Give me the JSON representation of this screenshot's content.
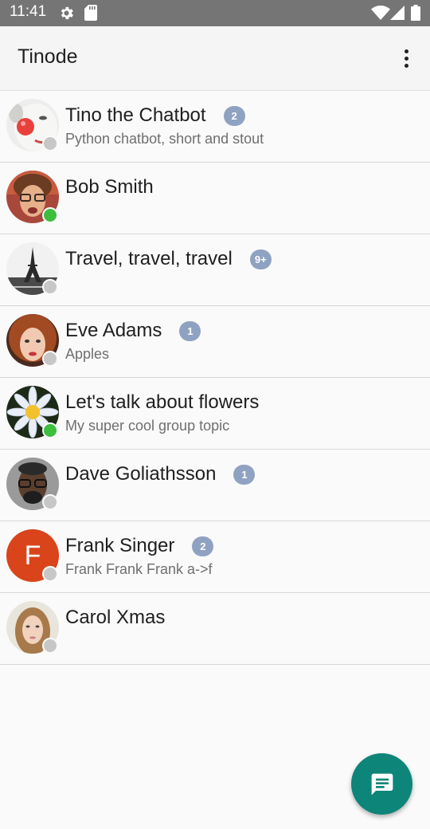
{
  "status_bar": {
    "time": "11:41",
    "icons": [
      "settings-icon",
      "sd-card-icon",
      "wifi-icon",
      "signal-icon",
      "battery-icon"
    ]
  },
  "app_bar": {
    "title": "Tinode",
    "menu_icon": "more-vert-icon"
  },
  "contacts": [
    {
      "name": "Tino the Chatbot",
      "subtitle": "Python chatbot, short and stout",
      "badge": "2",
      "online": false,
      "avatar": "photo"
    },
    {
      "name": "Bob Smith",
      "subtitle": "",
      "badge": "",
      "online": true,
      "avatar": "photo"
    },
    {
      "name": "Travel, travel, travel",
      "subtitle": "",
      "badge": "9+",
      "online": false,
      "avatar": "photo"
    },
    {
      "name": "Eve Adams",
      "subtitle": "Apples",
      "badge": "1",
      "online": false,
      "avatar": "photo"
    },
    {
      "name": "Let's talk about flowers",
      "subtitle": "My super cool group topic",
      "badge": "",
      "online": true,
      "avatar": "photo"
    },
    {
      "name": "Dave Goliathsson",
      "subtitle": "",
      "badge": "1",
      "online": false,
      "avatar": "photo"
    },
    {
      "name": "Frank Singer",
      "subtitle": "Frank Frank Frank a->f",
      "badge": "2",
      "online": false,
      "avatar": "letter",
      "avatar_letter": "F"
    },
    {
      "name": "Carol Xmas",
      "subtitle": "",
      "badge": "",
      "online": false,
      "avatar": "photo"
    }
  ],
  "fab": {
    "icon": "new-chat-icon"
  },
  "colors": {
    "status_bar": "#757575",
    "app_bar": "#f5f5f5",
    "badge": "#8fa2c2",
    "online": "#3dbe3d",
    "offline": "#c7c7c7",
    "fab": "#0d8579",
    "letter_avatar": "#d9441a"
  }
}
